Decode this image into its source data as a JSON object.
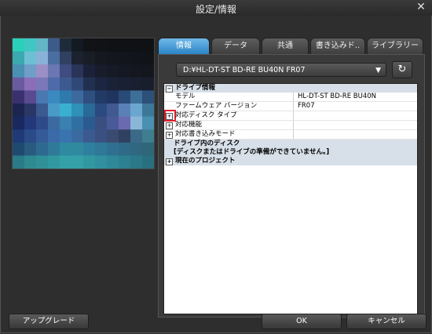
{
  "window": {
    "title": "設定/情報",
    "close": "✕"
  },
  "tabs": [
    {
      "label": "情報",
      "active": true
    },
    {
      "label": "データ",
      "active": false
    },
    {
      "label": "共通",
      "active": false
    },
    {
      "label": "書き込みド..",
      "active": false
    },
    {
      "label": "ライブラリー",
      "active": false
    }
  ],
  "drive": {
    "selected": "D:¥HL-DT-ST BD-RE BU40N FR07"
  },
  "tree": {
    "drive_info": {
      "title": "ドライブ情報",
      "toggle": "−"
    },
    "model": {
      "label": "モデル",
      "value": "HL-DT-ST BD-RE BU40N"
    },
    "firmware": {
      "label": "ファームウェア バージョン",
      "value": "FR07"
    },
    "disc_types": {
      "label": "対応ディスク タイプ",
      "toggle": "+"
    },
    "features": {
      "label": "対応機能",
      "toggle": "+"
    },
    "write_modes": {
      "label": "対応書き込みモード",
      "toggle": "+"
    },
    "disc_in_drive": {
      "title": "ドライブ内のディスク",
      "message": "[ディスクまたはドライブの準備ができていません。]"
    },
    "current_project": {
      "title": "現在のプロジェクト",
      "toggle": "+"
    }
  },
  "buttons": {
    "upgrade": "アップグレード",
    "ok": "OK",
    "cancel": "キャンセル"
  },
  "icons": {
    "refresh": "↻",
    "dropdown": "▼"
  },
  "colors": {
    "active_tab": "#2b84c6",
    "highlight": "#e0202a"
  }
}
